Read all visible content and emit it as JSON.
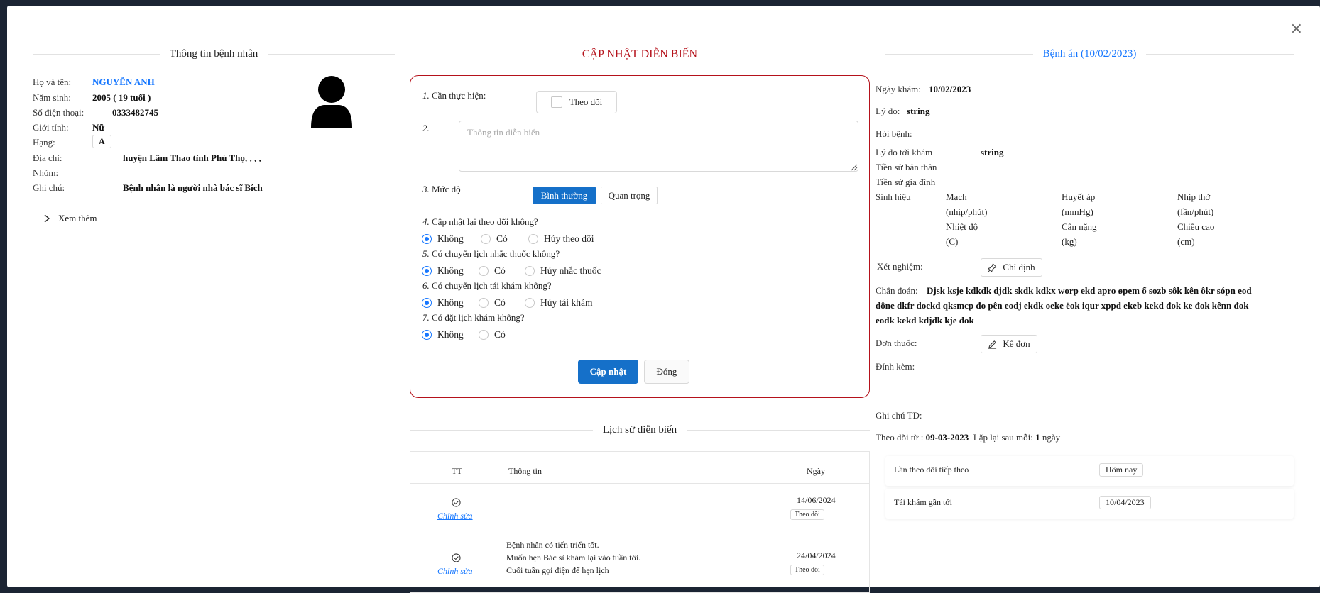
{
  "close_label": "×",
  "patient": {
    "title": "Thông tin bệnh nhân",
    "fields": [
      {
        "label": "Họ và tên:",
        "value": "NGUYỄN ANH"
      },
      {
        "label": "Năm sinh:",
        "value": "2005 ( 19 tuổi )"
      },
      {
        "label": "Số điện thoại:",
        "value": "0333482745"
      },
      {
        "label": "Giới tính:",
        "value": "Nữ"
      },
      {
        "label": "Hạng:",
        "value": "A"
      },
      {
        "label": "Địa chỉ:",
        "value": "huyện Lâm Thao tỉnh Phú Thọ, , , ,"
      },
      {
        "label": "Nhóm:",
        "value": ""
      },
      {
        "label": "Ghi chú:",
        "value": "Bệnh nhân là người nhà bác sĩ Bích"
      }
    ],
    "see_more": "Xem thêm"
  },
  "update": {
    "title": "CẬP NHẬT DIỄN BIẾN",
    "q1": {
      "num": "1.",
      "label": "Cần thực hiện:",
      "checkbox": "Theo dõi"
    },
    "q2": {
      "num": "2.",
      "placeholder": "Thông tin diễn biến"
    },
    "q3": {
      "num": "3.",
      "label": "Mức độ",
      "options": [
        "Bình thường",
        "Quan trọng"
      ],
      "selected": "Bình thường"
    },
    "q4": {
      "num": "4.",
      "label": "Cập nhật lại theo dõi không?",
      "options": [
        "Không",
        "Có",
        "Hủy theo dõi"
      ]
    },
    "q5": {
      "num": "5.",
      "label": "Có chuyển lịch nhắc thuốc không?",
      "options": [
        "Không",
        "Có",
        "Hủy nhắc thuốc"
      ]
    },
    "q6": {
      "num": "6.",
      "label": "Có chuyển lịch tái khám không?",
      "options": [
        "Không",
        "Có",
        "Hủy tái khám"
      ]
    },
    "q7": {
      "num": "7.",
      "label": "Có đặt lịch khám không?",
      "options": [
        "Không",
        "Có"
      ]
    },
    "submit": "Cập nhật",
    "close": "Đóng"
  },
  "history": {
    "title": "Lịch sử diễn biến",
    "columns": [
      "TT",
      "Thông tin",
      "Ngày"
    ],
    "rows": [
      {
        "edit": "Chỉnh sửa",
        "info": [],
        "date": "14/06/2024",
        "tag": "Theo dõi"
      },
      {
        "edit": "Chỉnh sửa",
        "info": [
          "Bệnh nhân có tiến triển tốt.",
          "Muốn hẹn Bác sĩ khám lại vào tuần tới.",
          "Cuối tuần gọi điện để hẹn lịch"
        ],
        "date": "24/04/2024",
        "tag": "Theo dõi"
      }
    ]
  },
  "record": {
    "title": "Bệnh án (10/02/2023)",
    "visit_date_label": "Ngày khám:",
    "visit_date": "10/02/2023",
    "reason_label": "Lý do:",
    "reason": "string",
    "history_label": "Hỏi bệnh:",
    "visit_reason_label": "Lý do tới khám",
    "visit_reason": "string",
    "personal_history_label": "Tiền sử bản thân",
    "family_history_label": "Tiền sử gia đình",
    "vitals_label": "Sinh hiệu",
    "vitals": [
      {
        "name": "Mạch",
        "unit": "(nhịp/phút)"
      },
      {
        "name": "Huyết áp",
        "unit": "(mmHg)"
      },
      {
        "name": "Nhịp thở",
        "unit": "(lần/phút)"
      },
      {
        "name": "Nhiệt độ",
        "unit": "(C)"
      },
      {
        "name": "Cân nặng",
        "unit": "(kg)"
      },
      {
        "name": "Chiều cao",
        "unit": "(cm)"
      }
    ],
    "tests_label": "Xét nghiệm:",
    "tests_button": "Chỉ định",
    "diagnosis_label": "Chẩn đoán:",
    "diagnosis_line1": "Djsk ksje kdkdk djdk skdk kdkx worp ekd apro øpem ố sozb sôk kên ôkr sópn eod",
    "diagnosis_line2": "dône dkfr dockd qksmcp đo pên eodj ekdk oeke ëok iqur xppd ekeb kekd đok ke đok kênn đok",
    "diagnosis_line3": "eodk kekd kdjdk kje đok",
    "prescription_label": "Đơn thuốc:",
    "prescription_button": "Kê đơn",
    "attachment_label": "Đính kèm:",
    "note_label": "Ghi chú TD:",
    "follow_from_label": "Theo dõi từ :",
    "follow_from": "09-03-2023",
    "repeat_label": "Lặp lại sau mỗi:",
    "repeat_value": "1",
    "repeat_unit": "ngày",
    "next_follow_label": "Lần theo dõi tiếp theo",
    "next_follow": "Hôm nay",
    "next_revisit_label": "Tái khám gần tới",
    "next_revisit": "10/04/2023"
  },
  "colors": {
    "accent": "#1677ff",
    "primary_button": "#1570c9",
    "title_red": "#b5121b"
  }
}
